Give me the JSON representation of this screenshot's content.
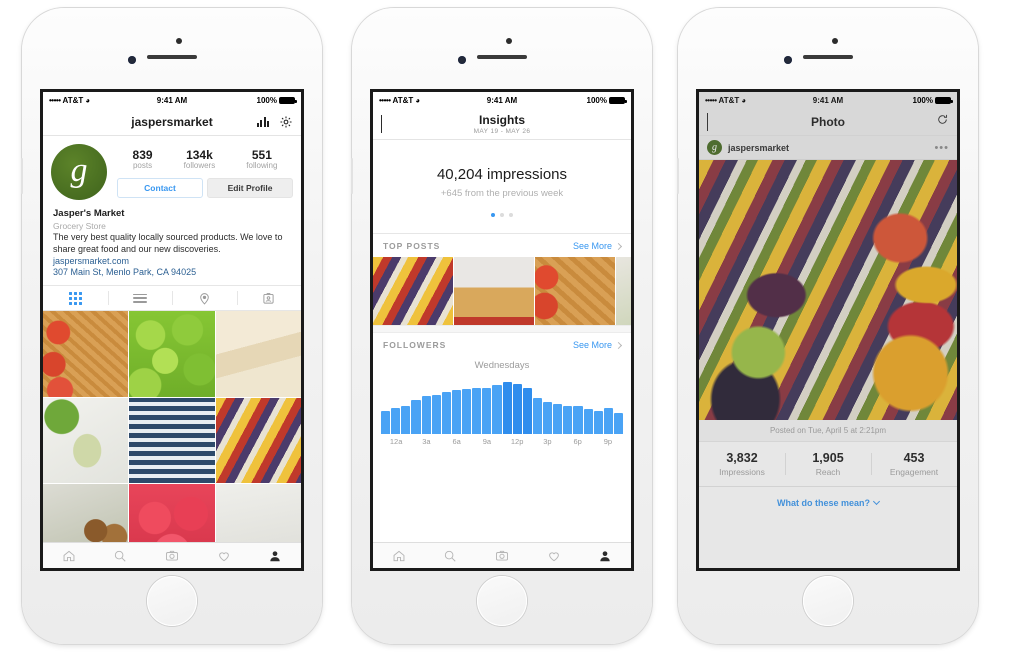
{
  "statusbar": {
    "carrier": "AT&T",
    "signal": "•••••",
    "wifi": "WiFi",
    "time": "9:41 AM",
    "battery": "100%"
  },
  "phone1": {
    "nav": {
      "title": "jaspersmarket",
      "insights_icon": "bar-chart-icon",
      "settings_icon": "gear-icon"
    },
    "stats": [
      {
        "num": "839",
        "label": "posts"
      },
      {
        "num": "134k",
        "label": "followers"
      },
      {
        "num": "551",
        "label": "following"
      }
    ],
    "buttons": {
      "contact": "Contact",
      "edit": "Edit Profile"
    },
    "bio": {
      "name": "Jasper's Market",
      "category": "Grocery Store",
      "description": "The very best quality locally sourced products. We love to share great food and our new discoveries.",
      "website": "jaspersmarket.com",
      "address": "307 Main St, Menlo Park, CA 94025"
    },
    "tabs": [
      {
        "name": "grid-view",
        "icon": "grid-icon",
        "active": true
      },
      {
        "name": "list-view",
        "icon": "list-icon",
        "active": false
      },
      {
        "name": "map-view",
        "icon": "location-pin-icon",
        "active": false
      },
      {
        "name": "tagged-view",
        "icon": "tagged-photos-icon",
        "active": false
      }
    ],
    "grid": [
      "apple-pie-with-apples",
      "green-apples",
      "brie-cheese",
      "chicken-wrap-salad",
      "fish-and-vegetables",
      "market-berry-stall",
      "onions-and-greens",
      "strawberries",
      "kitchen-scene"
    ]
  },
  "phone2": {
    "nav": {
      "back": "back-icon",
      "title": "Insights",
      "subtitle": "MAY 19 - MAY 26"
    },
    "hero": {
      "headline": "40,204 impressions",
      "subtext": "+645 from the previous week"
    },
    "pager": {
      "count": 3,
      "active": 0
    },
    "top_posts": {
      "title": "TOP POSTS",
      "see_more": "See More",
      "thumbs": [
        "market-produce-stall",
        "apple-pie-in-dish",
        "lattice-pie-with-apples",
        "scallions-and-bowl"
      ]
    },
    "followers": {
      "title": "FOLLOWERS",
      "see_more": "See More"
    }
  },
  "phone3": {
    "nav": {
      "back": "back-icon",
      "title": "Photo",
      "refresh": "refresh-icon"
    },
    "account": {
      "name": "jaspersmarket",
      "avatar": "jaspers-market-logo",
      "more": "more-options-icon"
    },
    "photo": "fruit-market-stall",
    "posted": "Posted on Tue, April 5 at 2:21pm",
    "metrics": [
      {
        "num": "3,832",
        "label": "Impressions"
      },
      {
        "num": "1,905",
        "label": "Reach"
      },
      {
        "num": "453",
        "label": "Engagement"
      }
    ],
    "explain_link": "What do these mean?"
  },
  "tabbar": [
    {
      "name": "home-icon"
    },
    {
      "name": "search-icon"
    },
    {
      "name": "camera-icon"
    },
    {
      "name": "heart-icon"
    },
    {
      "name": "profile-icon"
    }
  ],
  "colors": {
    "accent": "#3897f0",
    "bar": "#4aa3f5",
    "bar_dark": "#2f8ded",
    "logo_green": "#456a1f"
  },
  "chart_data": {
    "type": "bar",
    "title": "Wednesdays",
    "xlabel": "",
    "ylabel": "",
    "categories": [
      "12a",
      "1a",
      "2a",
      "3a",
      "4a",
      "5a",
      "6a",
      "7a",
      "8a",
      "9a",
      "10a",
      "11a",
      "12p",
      "1p",
      "2p",
      "3p",
      "4p",
      "5p",
      "6p",
      "7p",
      "8p",
      "9p",
      "10p",
      "11p"
    ],
    "tick_labels": [
      "12a",
      "3a",
      "6a",
      "9a",
      "12p",
      "3p",
      "6p",
      "9p"
    ],
    "values": [
      39,
      44,
      48,
      59,
      65,
      67,
      72,
      76,
      78,
      80,
      80,
      84,
      90,
      87,
      80,
      62,
      55,
      51,
      48,
      48,
      43,
      40,
      45,
      37
    ],
    "ylim": [
      0,
      100
    ],
    "grid": false,
    "legend": false
  }
}
